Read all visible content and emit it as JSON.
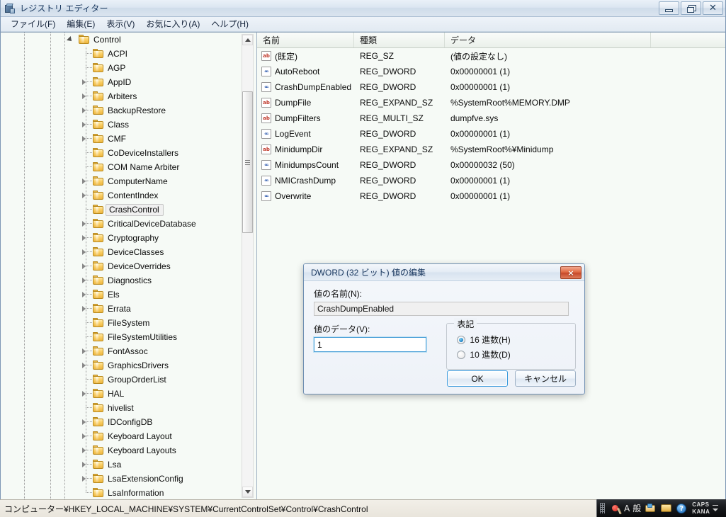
{
  "window": {
    "title": "レジストリ エディター",
    "app_icon": "registry-editor-icon",
    "buttons": {
      "minimize": "最小化",
      "restore": "元のサイズに戻す",
      "close": "閉じる"
    }
  },
  "menu": {
    "items": [
      {
        "label": "ファイル(F)",
        "name": "file"
      },
      {
        "label": "編集(E)",
        "name": "edit"
      },
      {
        "label": "表示(V)",
        "name": "view"
      },
      {
        "label": "お気に入り(A)",
        "name": "favorites"
      },
      {
        "label": "ヘルプ(H)",
        "name": "help"
      }
    ]
  },
  "tree": {
    "nodes": [
      {
        "label": "Control",
        "depth": 0,
        "expander": "open",
        "selected": false
      },
      {
        "label": "ACPI",
        "depth": 1,
        "expander": "none",
        "selected": false
      },
      {
        "label": "AGP",
        "depth": 1,
        "expander": "none",
        "selected": false
      },
      {
        "label": "AppID",
        "depth": 1,
        "expander": "closed",
        "selected": false
      },
      {
        "label": "Arbiters",
        "depth": 1,
        "expander": "closed",
        "selected": false
      },
      {
        "label": "BackupRestore",
        "depth": 1,
        "expander": "closed",
        "selected": false
      },
      {
        "label": "Class",
        "depth": 1,
        "expander": "closed",
        "selected": false
      },
      {
        "label": "CMF",
        "depth": 1,
        "expander": "closed",
        "selected": false
      },
      {
        "label": "CoDeviceInstallers",
        "depth": 1,
        "expander": "none",
        "selected": false
      },
      {
        "label": "COM Name Arbiter",
        "depth": 1,
        "expander": "none",
        "selected": false
      },
      {
        "label": "ComputerName",
        "depth": 1,
        "expander": "closed",
        "selected": false
      },
      {
        "label": "ContentIndex",
        "depth": 1,
        "expander": "closed",
        "selected": false
      },
      {
        "label": "CrashControl",
        "depth": 1,
        "expander": "none",
        "selected": true
      },
      {
        "label": "CriticalDeviceDatabase",
        "depth": 1,
        "expander": "closed",
        "selected": false
      },
      {
        "label": "Cryptography",
        "depth": 1,
        "expander": "closed",
        "selected": false
      },
      {
        "label": "DeviceClasses",
        "depth": 1,
        "expander": "closed",
        "selected": false
      },
      {
        "label": "DeviceOverrides",
        "depth": 1,
        "expander": "closed",
        "selected": false
      },
      {
        "label": "Diagnostics",
        "depth": 1,
        "expander": "closed",
        "selected": false
      },
      {
        "label": "Els",
        "depth": 1,
        "expander": "closed",
        "selected": false
      },
      {
        "label": "Errata",
        "depth": 1,
        "expander": "closed",
        "selected": false
      },
      {
        "label": "FileSystem",
        "depth": 1,
        "expander": "none",
        "selected": false
      },
      {
        "label": "FileSystemUtilities",
        "depth": 1,
        "expander": "none",
        "selected": false
      },
      {
        "label": "FontAssoc",
        "depth": 1,
        "expander": "closed",
        "selected": false
      },
      {
        "label": "GraphicsDrivers",
        "depth": 1,
        "expander": "closed",
        "selected": false
      },
      {
        "label": "GroupOrderList",
        "depth": 1,
        "expander": "none",
        "selected": false
      },
      {
        "label": "HAL",
        "depth": 1,
        "expander": "closed",
        "selected": false
      },
      {
        "label": "hivelist",
        "depth": 1,
        "expander": "none",
        "selected": false
      },
      {
        "label": "IDConfigDB",
        "depth": 1,
        "expander": "closed",
        "selected": false
      },
      {
        "label": "Keyboard Layout",
        "depth": 1,
        "expander": "closed",
        "selected": false
      },
      {
        "label": "Keyboard Layouts",
        "depth": 1,
        "expander": "closed",
        "selected": false
      },
      {
        "label": "Lsa",
        "depth": 1,
        "expander": "closed",
        "selected": false
      },
      {
        "label": "LsaExtensionConfig",
        "depth": 1,
        "expander": "closed",
        "selected": false
      },
      {
        "label": "LsaInformation",
        "depth": 1,
        "expander": "none",
        "selected": false
      }
    ]
  },
  "list": {
    "columns": [
      {
        "label": "名前",
        "name": "name"
      },
      {
        "label": "種類",
        "name": "type"
      },
      {
        "label": "データ",
        "name": "data"
      }
    ],
    "rows": [
      {
        "icon": "string-value-icon",
        "name": "(既定)",
        "type": "REG_SZ",
        "data": "(値の設定なし)"
      },
      {
        "icon": "dword-value-icon",
        "name": "AutoReboot",
        "type": "REG_DWORD",
        "data": "0x00000001 (1)"
      },
      {
        "icon": "dword-value-icon",
        "name": "CrashDumpEnabled",
        "type": "REG_DWORD",
        "data": "0x00000001 (1)"
      },
      {
        "icon": "string-value-icon",
        "name": "DumpFile",
        "type": "REG_EXPAND_SZ",
        "data": "%SystemRoot%MEMORY.DMP"
      },
      {
        "icon": "string-value-icon",
        "name": "DumpFilters",
        "type": "REG_MULTI_SZ",
        "data": "dumpfve.sys"
      },
      {
        "icon": "dword-value-icon",
        "name": "LogEvent",
        "type": "REG_DWORD",
        "data": "0x00000001 (1)"
      },
      {
        "icon": "string-value-icon",
        "name": "MinidumpDir",
        "type": "REG_EXPAND_SZ",
        "data": "%SystemRoot%¥Minidump"
      },
      {
        "icon": "dword-value-icon",
        "name": "MinidumpsCount",
        "type": "REG_DWORD",
        "data": "0x00000032 (50)"
      },
      {
        "icon": "dword-value-icon",
        "name": "NMICrashDump",
        "type": "REG_DWORD",
        "data": "0x00000001 (1)"
      },
      {
        "icon": "dword-value-icon",
        "name": "Overwrite",
        "type": "REG_DWORD",
        "data": "0x00000001 (1)"
      }
    ],
    "icon_glyphs": {
      "string": "ab",
      "dword": "011\n100"
    }
  },
  "statusbar": {
    "path": "コンピューター¥HKEY_LOCAL_MACHINE¥SYSTEM¥CurrentControlSet¥Control¥CrashControl"
  },
  "ime": {
    "tools": [
      {
        "name": "ime-mode-icon",
        "glyph": "●"
      },
      {
        "name": "input-mode-a-label",
        "glyph": "A"
      },
      {
        "name": "input-mode-kanji-label",
        "glyph": "般"
      },
      {
        "name": "conversion-mode-icon",
        "glyph": "◆"
      },
      {
        "name": "ime-pad-icon",
        "glyph": "▣"
      },
      {
        "name": "help-icon",
        "glyph": "?"
      }
    ],
    "caps_label": "CAPS",
    "kana_label": "KANA"
  },
  "dialog": {
    "title": "DWORD (32 ビット) 値の編集",
    "close_label": "×",
    "name_label": "値の名前(N):",
    "name_value": "CrashDumpEnabled",
    "data_label": "値のデータ(V):",
    "data_value": "1",
    "base_legend": "表記",
    "base_options": [
      {
        "label": "16 進数(H)",
        "selected": true,
        "name": "hexadecimal"
      },
      {
        "label": "10 進数(D)",
        "selected": false,
        "name": "decimal"
      }
    ],
    "ok_label": "OK",
    "cancel_label": "キャンセル"
  },
  "colors": {
    "title_text": "#15345c",
    "accent_focus": "#3c9bdc",
    "folder": "#fbd169",
    "dialog_close": "#e06a42"
  }
}
